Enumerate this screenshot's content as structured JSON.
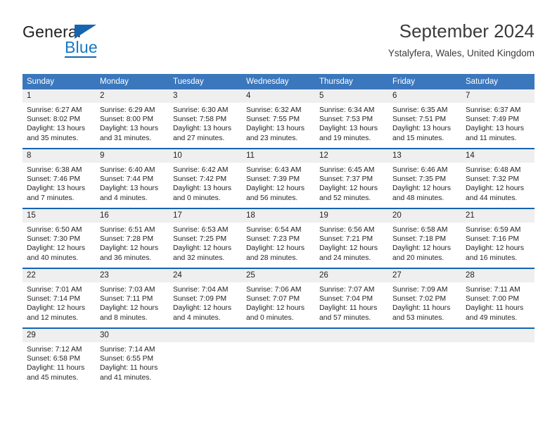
{
  "logo": {
    "word_one": "General",
    "word_two": "Blue",
    "triangle_icon": "blue-triangle-icon",
    "colors": {
      "general_text": "#231f20",
      "blue_text": "#1579c8",
      "triangle": "#1565b0"
    }
  },
  "header": {
    "title": "September 2024",
    "subtitle": "Ystalyfera, Wales, United Kingdom"
  },
  "theme": {
    "header_row_bg": "#3b77bc",
    "header_row_text": "#ffffff",
    "week_separator": "#1565b0",
    "daynum_band_bg": "#efefef",
    "body_text": "#231f20"
  },
  "calendar": {
    "weekday_headers": [
      "Sunday",
      "Monday",
      "Tuesday",
      "Wednesday",
      "Thursday",
      "Friday",
      "Saturday"
    ],
    "weeks": [
      [
        {
          "day": "1",
          "sunrise": "Sunrise: 6:27 AM",
          "sunset": "Sunset: 8:02 PM",
          "daylight_line1": "Daylight: 13 hours",
          "daylight_line2": "and 35 minutes."
        },
        {
          "day": "2",
          "sunrise": "Sunrise: 6:29 AM",
          "sunset": "Sunset: 8:00 PM",
          "daylight_line1": "Daylight: 13 hours",
          "daylight_line2": "and 31 minutes."
        },
        {
          "day": "3",
          "sunrise": "Sunrise: 6:30 AM",
          "sunset": "Sunset: 7:58 PM",
          "daylight_line1": "Daylight: 13 hours",
          "daylight_line2": "and 27 minutes."
        },
        {
          "day": "4",
          "sunrise": "Sunrise: 6:32 AM",
          "sunset": "Sunset: 7:55 PM",
          "daylight_line1": "Daylight: 13 hours",
          "daylight_line2": "and 23 minutes."
        },
        {
          "day": "5",
          "sunrise": "Sunrise: 6:34 AM",
          "sunset": "Sunset: 7:53 PM",
          "daylight_line1": "Daylight: 13 hours",
          "daylight_line2": "and 19 minutes."
        },
        {
          "day": "6",
          "sunrise": "Sunrise: 6:35 AM",
          "sunset": "Sunset: 7:51 PM",
          "daylight_line1": "Daylight: 13 hours",
          "daylight_line2": "and 15 minutes."
        },
        {
          "day": "7",
          "sunrise": "Sunrise: 6:37 AM",
          "sunset": "Sunset: 7:49 PM",
          "daylight_line1": "Daylight: 13 hours",
          "daylight_line2": "and 11 minutes."
        }
      ],
      [
        {
          "day": "8",
          "sunrise": "Sunrise: 6:38 AM",
          "sunset": "Sunset: 7:46 PM",
          "daylight_line1": "Daylight: 13 hours",
          "daylight_line2": "and 7 minutes."
        },
        {
          "day": "9",
          "sunrise": "Sunrise: 6:40 AM",
          "sunset": "Sunset: 7:44 PM",
          "daylight_line1": "Daylight: 13 hours",
          "daylight_line2": "and 4 minutes."
        },
        {
          "day": "10",
          "sunrise": "Sunrise: 6:42 AM",
          "sunset": "Sunset: 7:42 PM",
          "daylight_line1": "Daylight: 13 hours",
          "daylight_line2": "and 0 minutes."
        },
        {
          "day": "11",
          "sunrise": "Sunrise: 6:43 AM",
          "sunset": "Sunset: 7:39 PM",
          "daylight_line1": "Daylight: 12 hours",
          "daylight_line2": "and 56 minutes."
        },
        {
          "day": "12",
          "sunrise": "Sunrise: 6:45 AM",
          "sunset": "Sunset: 7:37 PM",
          "daylight_line1": "Daylight: 12 hours",
          "daylight_line2": "and 52 minutes."
        },
        {
          "day": "13",
          "sunrise": "Sunrise: 6:46 AM",
          "sunset": "Sunset: 7:35 PM",
          "daylight_line1": "Daylight: 12 hours",
          "daylight_line2": "and 48 minutes."
        },
        {
          "day": "14",
          "sunrise": "Sunrise: 6:48 AM",
          "sunset": "Sunset: 7:32 PM",
          "daylight_line1": "Daylight: 12 hours",
          "daylight_line2": "and 44 minutes."
        }
      ],
      [
        {
          "day": "15",
          "sunrise": "Sunrise: 6:50 AM",
          "sunset": "Sunset: 7:30 PM",
          "daylight_line1": "Daylight: 12 hours",
          "daylight_line2": "and 40 minutes."
        },
        {
          "day": "16",
          "sunrise": "Sunrise: 6:51 AM",
          "sunset": "Sunset: 7:28 PM",
          "daylight_line1": "Daylight: 12 hours",
          "daylight_line2": "and 36 minutes."
        },
        {
          "day": "17",
          "sunrise": "Sunrise: 6:53 AM",
          "sunset": "Sunset: 7:25 PM",
          "daylight_line1": "Daylight: 12 hours",
          "daylight_line2": "and 32 minutes."
        },
        {
          "day": "18",
          "sunrise": "Sunrise: 6:54 AM",
          "sunset": "Sunset: 7:23 PM",
          "daylight_line1": "Daylight: 12 hours",
          "daylight_line2": "and 28 minutes."
        },
        {
          "day": "19",
          "sunrise": "Sunrise: 6:56 AM",
          "sunset": "Sunset: 7:21 PM",
          "daylight_line1": "Daylight: 12 hours",
          "daylight_line2": "and 24 minutes."
        },
        {
          "day": "20",
          "sunrise": "Sunrise: 6:58 AM",
          "sunset": "Sunset: 7:18 PM",
          "daylight_line1": "Daylight: 12 hours",
          "daylight_line2": "and 20 minutes."
        },
        {
          "day": "21",
          "sunrise": "Sunrise: 6:59 AM",
          "sunset": "Sunset: 7:16 PM",
          "daylight_line1": "Daylight: 12 hours",
          "daylight_line2": "and 16 minutes."
        }
      ],
      [
        {
          "day": "22",
          "sunrise": "Sunrise: 7:01 AM",
          "sunset": "Sunset: 7:14 PM",
          "daylight_line1": "Daylight: 12 hours",
          "daylight_line2": "and 12 minutes."
        },
        {
          "day": "23",
          "sunrise": "Sunrise: 7:03 AM",
          "sunset": "Sunset: 7:11 PM",
          "daylight_line1": "Daylight: 12 hours",
          "daylight_line2": "and 8 minutes."
        },
        {
          "day": "24",
          "sunrise": "Sunrise: 7:04 AM",
          "sunset": "Sunset: 7:09 PM",
          "daylight_line1": "Daylight: 12 hours",
          "daylight_line2": "and 4 minutes."
        },
        {
          "day": "25",
          "sunrise": "Sunrise: 7:06 AM",
          "sunset": "Sunset: 7:07 PM",
          "daylight_line1": "Daylight: 12 hours",
          "daylight_line2": "and 0 minutes."
        },
        {
          "day": "26",
          "sunrise": "Sunrise: 7:07 AM",
          "sunset": "Sunset: 7:04 PM",
          "daylight_line1": "Daylight: 11 hours",
          "daylight_line2": "and 57 minutes."
        },
        {
          "day": "27",
          "sunrise": "Sunrise: 7:09 AM",
          "sunset": "Sunset: 7:02 PM",
          "daylight_line1": "Daylight: 11 hours",
          "daylight_line2": "and 53 minutes."
        },
        {
          "day": "28",
          "sunrise": "Sunrise: 7:11 AM",
          "sunset": "Sunset: 7:00 PM",
          "daylight_line1": "Daylight: 11 hours",
          "daylight_line2": "and 49 minutes."
        }
      ],
      [
        {
          "day": "29",
          "sunrise": "Sunrise: 7:12 AM",
          "sunset": "Sunset: 6:58 PM",
          "daylight_line1": "Daylight: 11 hours",
          "daylight_line2": "and 45 minutes."
        },
        {
          "day": "30",
          "sunrise": "Sunrise: 7:14 AM",
          "sunset": "Sunset: 6:55 PM",
          "daylight_line1": "Daylight: 11 hours",
          "daylight_line2": "and 41 minutes."
        },
        {
          "day": "",
          "sunrise": "",
          "sunset": "",
          "daylight_line1": "",
          "daylight_line2": ""
        },
        {
          "day": "",
          "sunrise": "",
          "sunset": "",
          "daylight_line1": "",
          "daylight_line2": ""
        },
        {
          "day": "",
          "sunrise": "",
          "sunset": "",
          "daylight_line1": "",
          "daylight_line2": ""
        },
        {
          "day": "",
          "sunrise": "",
          "sunset": "",
          "daylight_line1": "",
          "daylight_line2": ""
        },
        {
          "day": "",
          "sunrise": "",
          "sunset": "",
          "daylight_line1": "",
          "daylight_line2": ""
        }
      ]
    ]
  }
}
